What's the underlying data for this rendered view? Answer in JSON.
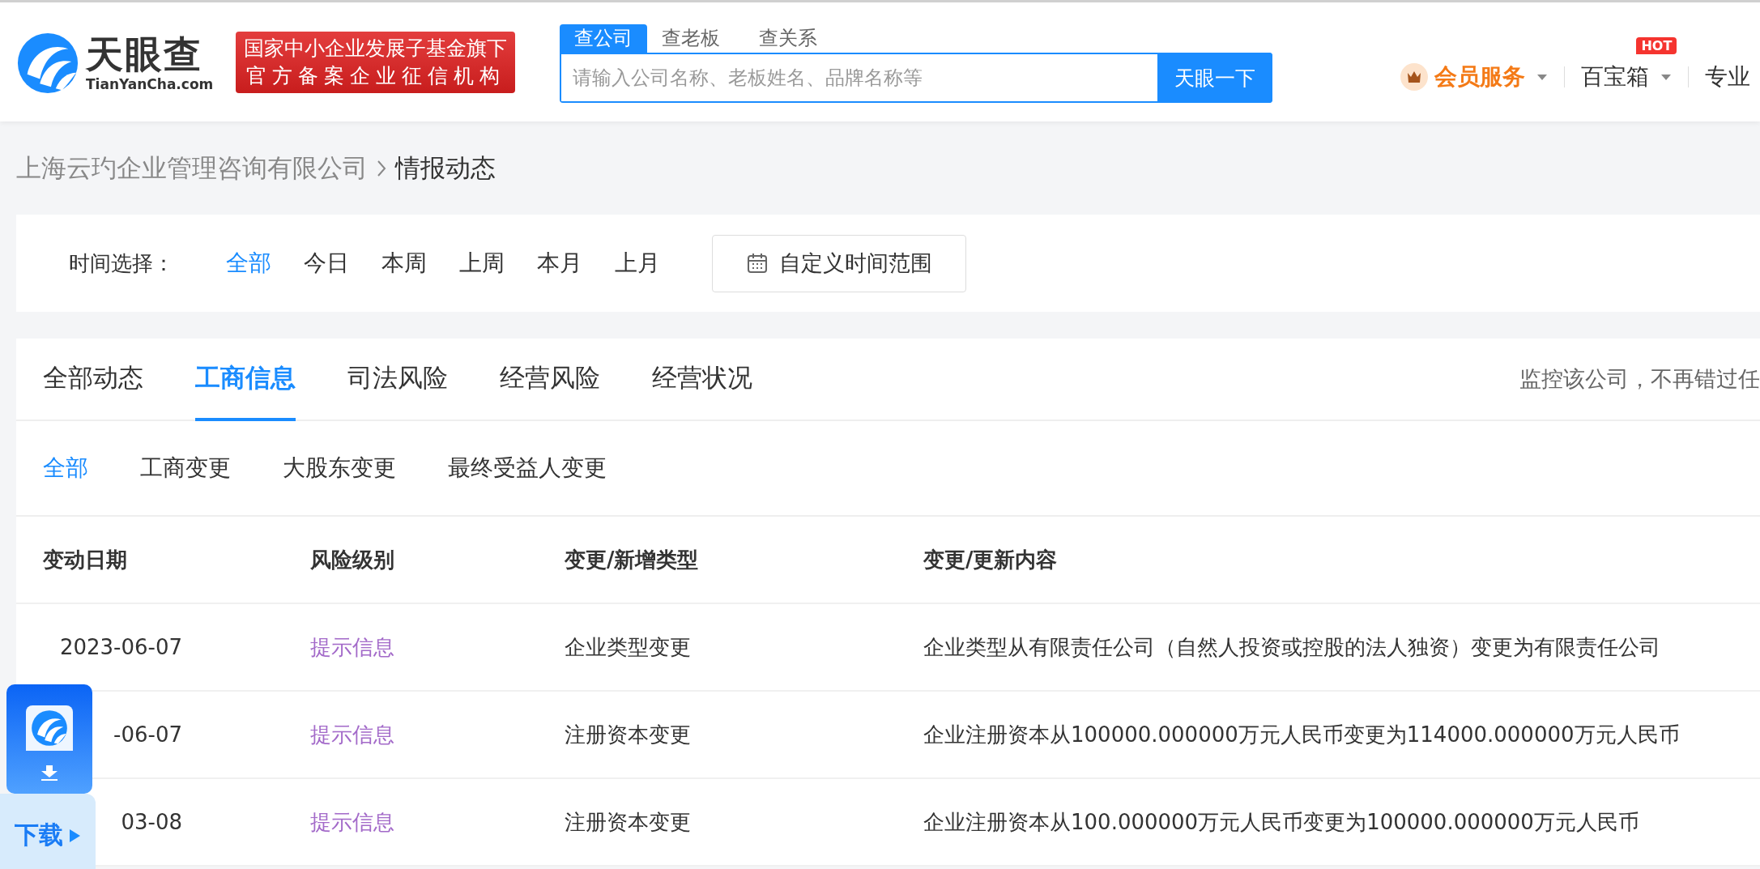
{
  "header": {
    "logo": {
      "name": "天眼查",
      "domain": "TianYanCha.com"
    },
    "badge": [
      "国家中小企业发展子基金旗下",
      "官方备案企业征信机构"
    ],
    "search": {
      "tabs": [
        {
          "label": "查公司",
          "selected": true
        },
        {
          "label": "查老板",
          "selected": false
        },
        {
          "label": "查关系",
          "selected": false
        }
      ],
      "placeholder": "请输入公司名称、老板姓名、品牌名称等",
      "button": "天眼一下"
    },
    "nav": [
      {
        "kind": "member",
        "label": "会员服务",
        "dropdown": true
      },
      {
        "kind": "plain",
        "label": "百宝箱",
        "dropdown": true,
        "badge": "HOT"
      },
      {
        "kind": "plain",
        "label": "专业",
        "dropdown": false
      }
    ]
  },
  "breadcrumb": [
    "上海云玓企业管理咨询有限公司",
    "情报动态"
  ],
  "time_filter": {
    "label": "时间选择：",
    "options": [
      {
        "label": "全部",
        "selected": true
      },
      {
        "label": "今日",
        "selected": false
      },
      {
        "label": "本周",
        "selected": false
      },
      {
        "label": "上周",
        "selected": false
      },
      {
        "label": "本月",
        "selected": false
      },
      {
        "label": "上月",
        "selected": false
      }
    ],
    "custom_button": "自定义时间范围"
  },
  "tabs": [
    {
      "label": "全部动态",
      "selected": false
    },
    {
      "label": "工商信息",
      "selected": true
    },
    {
      "label": "司法风险",
      "selected": false
    },
    {
      "label": "经营风险",
      "selected": false
    },
    {
      "label": "经营状况",
      "selected": false
    }
  ],
  "monitor_text": "监控该公司，不再错过任",
  "subtabs": [
    {
      "label": "全部",
      "selected": true
    },
    {
      "label": "工商变更",
      "selected": false
    },
    {
      "label": "大股东变更",
      "selected": false
    },
    {
      "label": "最终受益人变更",
      "selected": false
    }
  ],
  "table": {
    "columns": [
      "变动日期",
      "风险级别",
      "变更/新增类型",
      "变更/更新内容"
    ],
    "rows": [
      {
        "date": "2023-06-07",
        "risk": "提示信息",
        "type": "企业类型变更",
        "content": "企业类型从有限责任公司（自然人投资或控股的法人独资）变更为有限责任公司"
      },
      {
        "date": "-06-07",
        "risk": "提示信息",
        "type": "注册资本变更",
        "content": "企业注册资本从100000.000000万元人民币变更为114000.000000万元人民币"
      },
      {
        "date": "03-08",
        "risk": "提示信息",
        "type": "注册资本变更",
        "content": "企业注册资本从100.000000万元人民币变更为100000.000000万元人民币"
      }
    ]
  },
  "download_widget": {
    "label": "下载"
  }
}
